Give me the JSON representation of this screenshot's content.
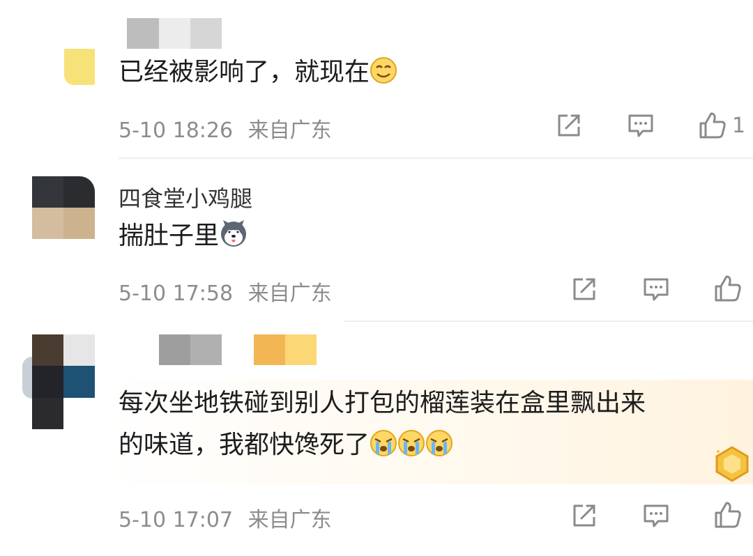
{
  "comments": [
    {
      "text": "已经被影响了，就现在",
      "time": "5-10 18:26",
      "location": "来自广东",
      "likes": "1",
      "text_emoji": "smirk-emoji"
    },
    {
      "username": "四食堂小鸡腿",
      "text": "揣肚子里",
      "time": "5-10 17:58",
      "location": "来自广东",
      "text_emoji": "husky-dog-emoji"
    },
    {
      "text_line1": "每次坐地铁碰到别人打包的榴莲装在盒里飘出来",
      "text_line2": "的味道，我都快馋死了",
      "time": "5-10 17:07",
      "location": "来自广东",
      "text_emoji": "crying-emoji",
      "text_emoji_count": 3
    }
  ],
  "icons": {
    "share": "share-icon",
    "comment": "comment-icon",
    "like": "thumbs-up-icon"
  },
  "colors": {
    "meta_text": "#8c8c8c",
    "icon_stroke": "#8a8a8a",
    "highlight_card": "#fff3df",
    "badge": "#f5c343"
  }
}
